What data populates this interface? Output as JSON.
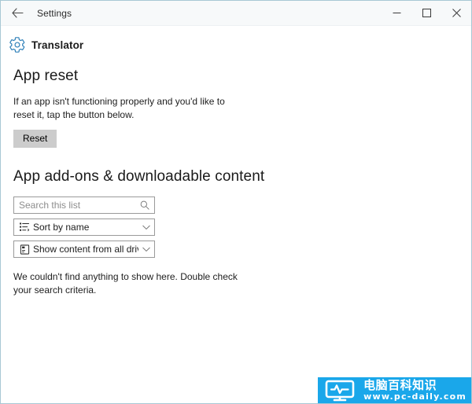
{
  "window": {
    "title": "Settings",
    "back_label": "Back",
    "controls": {
      "minimize": "Minimize",
      "maximize": "Maximize",
      "close": "Close"
    }
  },
  "app_header": {
    "icon": "gear-icon",
    "name": "Translator"
  },
  "sections": {
    "app_reset": {
      "title": "App reset",
      "description": "If an app isn't functioning properly and you'd like to reset it, tap the button below.",
      "reset_button": "Reset"
    },
    "addons": {
      "title": "App add-ons & downloadable content",
      "search": {
        "placeholder": "Search this list",
        "value": "",
        "icon": "search-icon"
      },
      "sort_dropdown": {
        "value": "Sort by name",
        "icon": "sort-list-icon",
        "chevron": "chevron-down-icon"
      },
      "drives_dropdown": {
        "value": "Show content from all drives",
        "icon": "drive-icon",
        "chevron": "chevron-down-icon"
      },
      "empty_message": "We couldn't find anything to show here. Double check your search criteria."
    }
  },
  "watermark": {
    "logo": "monitor-pulse-icon",
    "chinese_text": "电脑百科知识",
    "url": "www.pc-daily.com",
    "color": "#1aa7ea"
  }
}
